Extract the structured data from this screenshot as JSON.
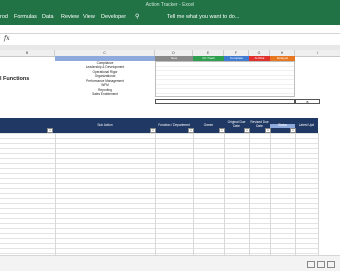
{
  "window": {
    "title": "Action Tracker - Excel"
  },
  "ribbon": {
    "tabs": [
      "rod",
      "Formulas",
      "Data",
      "Review",
      "View",
      "Developer"
    ],
    "tell_me": "Tell me what you want to do..."
  },
  "formula_bar": {
    "fx": "fx"
  },
  "columns": {
    "b": "B",
    "c": "C",
    "d": "D",
    "e": "E",
    "f": "F",
    "g": "G",
    "h": "H",
    "i": "I"
  },
  "summary": {
    "title": "l Functions",
    "categories": [
      "Compliance",
      "Leadership & Development",
      "Operational Rigor",
      "Organizational",
      "Performance Management",
      "WFM",
      "Reporting",
      "Sales Enablement"
    ],
    "status_headers": {
      "new": "New",
      "on_track": "On Track",
      "complete": "Complete",
      "at_risk": "At Risk",
      "delayed": "Delayed"
    },
    "marker": "B",
    "colors": {
      "new": "#8a8a8a",
      "on_track": "#2e9e4f",
      "complete": "#3e7bd1",
      "at_risk": "#e0312c",
      "delayed": "#e87722"
    }
  },
  "table": {
    "headers": {
      "sub_action": "Sub Action",
      "function": "Function / Department",
      "owner": "Owner",
      "orig_due": "Original Due Date",
      "revised_due": "Revised Due Date",
      "status": "Status",
      "latest": "Latest Upd"
    }
  }
}
